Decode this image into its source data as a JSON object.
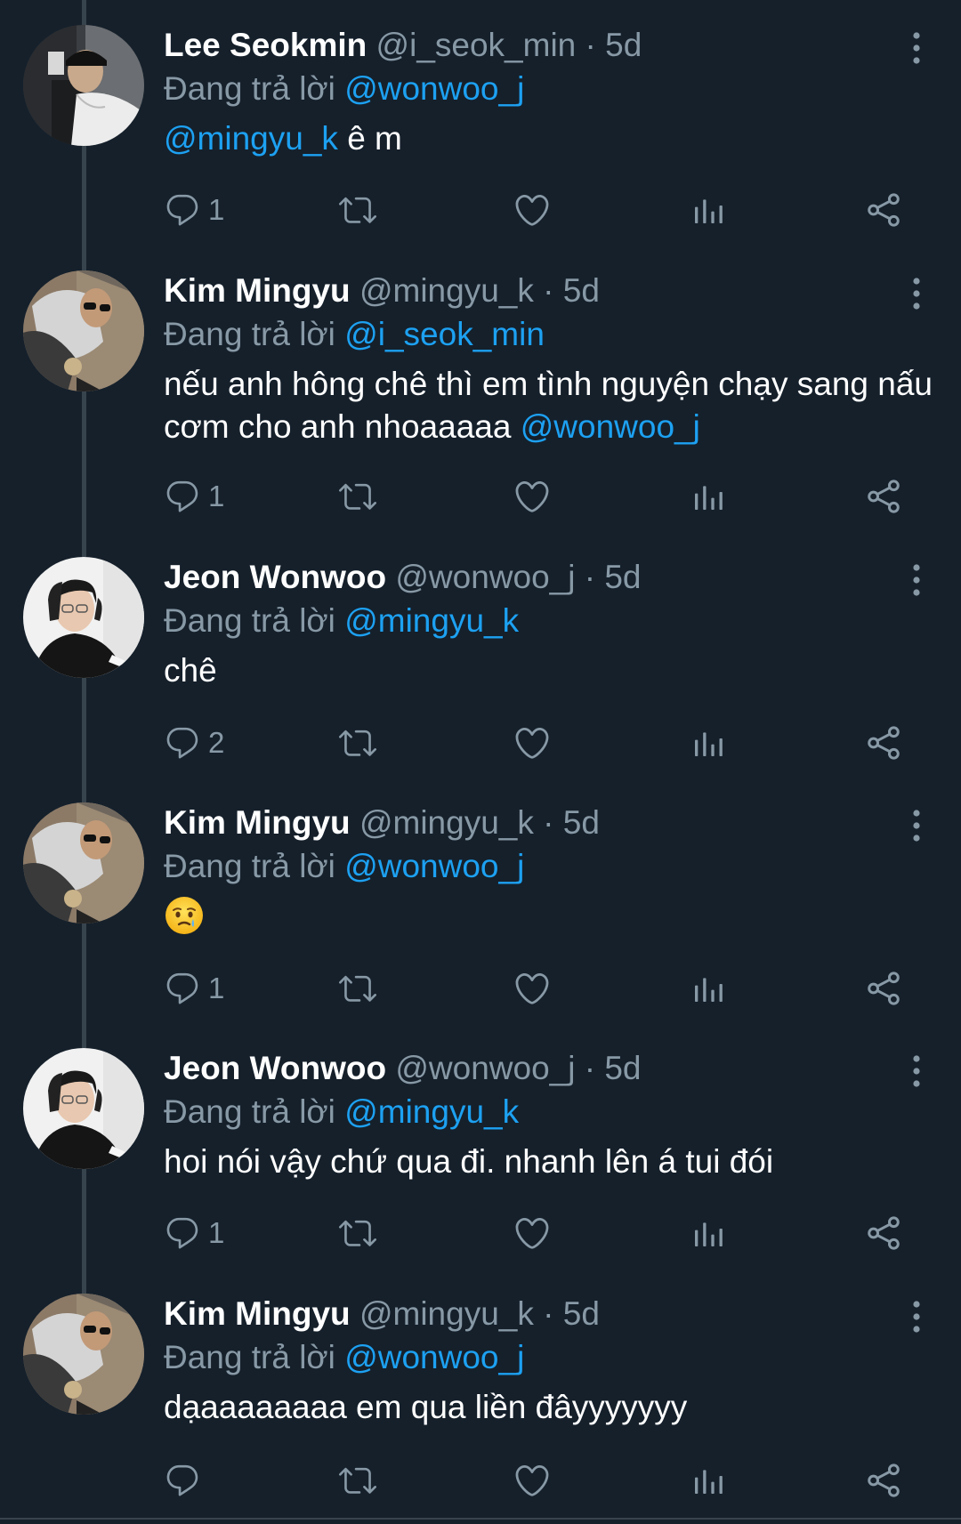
{
  "reply_prefix": "Đang trả lời",
  "tweets": [
    {
      "name": "Lee Seokmin",
      "handle": "@i_seok_min",
      "separator": "·",
      "time": "5d",
      "reply_to": "@wonwoo_j",
      "body_mention": "@mingyu_k",
      "body": " ê m",
      "body_mention_end": "",
      "replies": "1",
      "avatar": "lee-seokmin-avatar"
    },
    {
      "name": "Kim Mingyu",
      "handle": "@mingyu_k",
      "separator": "·",
      "time": "5d",
      "reply_to": "@i_seok_min",
      "body_mention": "",
      "body": "nếu anh hông chê thì em tình nguyện chạy sang nấu cơm cho anh nhoaaaaa ",
      "body_mention_end": "@wonwoo_j",
      "replies": "1",
      "avatar": "kim-mingyu-avatar"
    },
    {
      "name": "Jeon Wonwoo",
      "handle": "@wonwoo_j",
      "separator": "·",
      "time": "5d",
      "reply_to": "@mingyu_k",
      "body_mention": "",
      "body": "chê",
      "body_mention_end": "",
      "replies": "2",
      "avatar": "jeon-wonwoo-avatar"
    },
    {
      "name": "Kim Mingyu",
      "handle": "@mingyu_k",
      "separator": "·",
      "time": "5d",
      "reply_to": "@wonwoo_j",
      "body_mention": "",
      "body": "",
      "body_mention_end": "",
      "emoji": "crying-face-emoji",
      "replies": "1",
      "avatar": "kim-mingyu-avatar"
    },
    {
      "name": "Jeon Wonwoo",
      "handle": "@wonwoo_j",
      "separator": "·",
      "time": "5d",
      "reply_to": "@mingyu_k",
      "body_mention": "",
      "body": "hoi nói vậy chứ qua đi. nhanh lên á tui đói",
      "body_mention_end": "",
      "replies": "1",
      "avatar": "jeon-wonwoo-avatar"
    },
    {
      "name": "Kim Mingyu",
      "handle": "@mingyu_k",
      "separator": "·",
      "time": "5d",
      "reply_to": "@wonwoo_j",
      "body_mention": "",
      "body": "dạaaaaaaaa em qua liền đâyyyyyyy",
      "body_mention_end": "",
      "replies": "",
      "avatar": "kim-mingyu-avatar"
    }
  ],
  "icons": {
    "reply": "reply-icon",
    "retweet": "retweet-icon",
    "like": "heart-icon",
    "analytics": "analytics-icon",
    "share": "share-icon",
    "more": "more-options-icon"
  },
  "colors": {
    "background": "#15202b",
    "link": "#1da1f2",
    "secondary_text": "#8899a6",
    "thread_line": "#38444d"
  }
}
